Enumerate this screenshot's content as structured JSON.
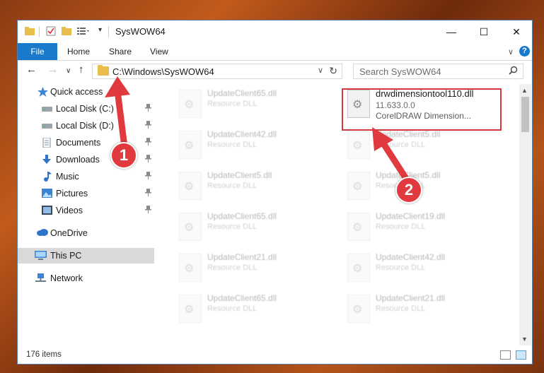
{
  "window": {
    "title": "SysWOW64",
    "controls": {
      "minimize": "—",
      "maximize": "☐",
      "close": "✕"
    }
  },
  "ribbon": {
    "tabs": [
      "File",
      "Home",
      "Share",
      "View"
    ],
    "toggle": "∨",
    "help": "?"
  },
  "nav": {
    "back": "←",
    "forward": "→",
    "recent": "∨",
    "up": "↑",
    "address": "C:\\Windows\\SysWOW64",
    "address_dropdown": "∨",
    "refresh": "↻",
    "search_placeholder": "Search SysWOW64"
  },
  "sidebar": {
    "items": [
      {
        "label": "Quick access",
        "icon": "star-icon",
        "pinned": false
      },
      {
        "label": "Local Disk (C:)",
        "icon": "drive-icon",
        "pinned": true
      },
      {
        "label": "Local Disk (D:)",
        "icon": "drive-icon",
        "pinned": true
      },
      {
        "label": "Documents",
        "icon": "documents-icon",
        "pinned": true
      },
      {
        "label": "Downloads",
        "icon": "download-icon",
        "pinned": true
      },
      {
        "label": "Music",
        "icon": "music-icon",
        "pinned": true
      },
      {
        "label": "Pictures",
        "icon": "pictures-icon",
        "pinned": true
      },
      {
        "label": "Videos",
        "icon": "videos-icon",
        "pinned": true
      },
      {
        "label": "OneDrive",
        "icon": "cloud-icon",
        "pinned": false
      },
      {
        "label": "This PC",
        "icon": "computer-icon",
        "pinned": false
      },
      {
        "label": "Network",
        "icon": "network-icon",
        "pinned": false
      }
    ],
    "pin_glyph": "📌"
  },
  "files": {
    "highlighted": {
      "name": "drwdimensiontool110.dll",
      "version": "11.633.0.0",
      "description": "CorelDRAW Dimension..."
    },
    "left_column": [
      {
        "name": "UpdateClient65.dll",
        "type": "Resource DLL"
      },
      {
        "name": "UpdateClient42.dll",
        "type": "Resource DLL"
      },
      {
        "name": "UpdateClient5.dll",
        "type": "Resource DLL"
      },
      {
        "name": "UpdateClient65.dll",
        "type": "Resource DLL"
      },
      {
        "name": "UpdateClient21.dll",
        "type": "Resource DLL"
      },
      {
        "name": "UpdateClient65.dll",
        "type": "Resource DLL"
      }
    ],
    "right_column": [
      {
        "name": "UpdateClient5.dll",
        "type": "Resource DLL"
      },
      {
        "name": "UpdateClient5.dll",
        "type": "Resource DLL"
      },
      {
        "name": "UpdateClient19.dll",
        "type": "Resource DLL"
      },
      {
        "name": "UpdateClient42.dll",
        "type": "Resource DLL"
      },
      {
        "name": "UpdateClient21.dll",
        "type": "Resource DLL"
      }
    ]
  },
  "status": {
    "item_count": "176 items"
  },
  "annotations": {
    "badge1": "1",
    "badge2": "2",
    "color": "#e03a3e"
  },
  "colors": {
    "accent": "#1979ca",
    "highlight": "#d3383f"
  }
}
